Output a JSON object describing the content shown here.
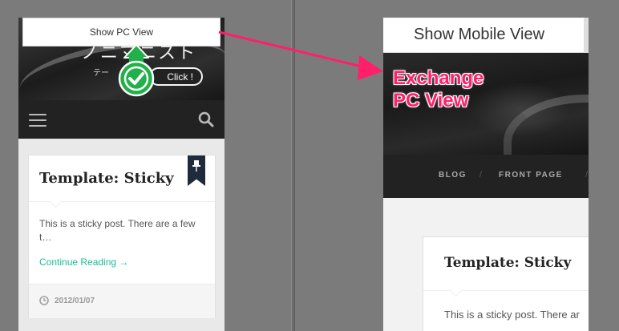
{
  "left_phone": {
    "view_toggle_label": "Show PC View",
    "site_title": "ノニマニスト",
    "site_tagline": "テー",
    "click_hint": "Click !",
    "post": {
      "title": "Template: Sticky",
      "excerpt": "This is a sticky post. There are a few t…",
      "read_more": "Continue Reading →",
      "date": "2012/01/07"
    }
  },
  "right_phone": {
    "view_toggle_label": "Show Mobile View",
    "nav_items": [
      "BLOG",
      "FRONT PAGE"
    ],
    "post": {
      "title": "Template: Sticky",
      "excerpt": "This is a sticky post. There ar"
    }
  },
  "annotation": {
    "line1": "Exchange",
    "line2": "PC View",
    "color": "#ff1f6b"
  },
  "colors": {
    "accent_link": "#1abc9c",
    "check_badge": "#22b04b",
    "bookmark": "#1f2a3a"
  }
}
